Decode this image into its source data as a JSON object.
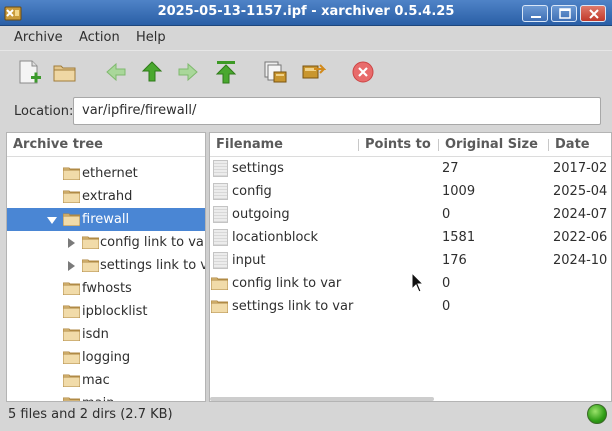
{
  "window": {
    "title": "2025-05-13-1157.ipf - xarchiver 0.5.4.25"
  },
  "menubar": {
    "items": [
      "Archive",
      "Action",
      "Help"
    ]
  },
  "toolbar": {
    "icons": [
      "new-archive-icon",
      "open-archive-icon",
      "back-arrow-icon",
      "up-arrow-icon",
      "forward-arrow-icon",
      "top-level-icon",
      "extract-icon",
      "add-files-icon",
      "stop-icon"
    ]
  },
  "location": {
    "label": "Location:",
    "value": "var/ipfire/firewall/"
  },
  "tree": {
    "header": "Archive tree",
    "items": [
      {
        "label": "ethernet",
        "selected": false
      },
      {
        "label": "extrahd",
        "selected": false
      },
      {
        "label": "firewall",
        "selected": true
      },
      {
        "label": "config link to var",
        "selected": false
      },
      {
        "label": "settings link to var",
        "selected": false
      },
      {
        "label": "fwhosts",
        "selected": false
      },
      {
        "label": "ipblocklist",
        "selected": false
      },
      {
        "label": "isdn",
        "selected": false
      },
      {
        "label": "logging",
        "selected": false
      },
      {
        "label": "mac",
        "selected": false
      },
      {
        "label": "main",
        "selected": false
      }
    ]
  },
  "files": {
    "columns": [
      "Filename",
      "Points to",
      "Original Size",
      "Date"
    ],
    "rows": [
      {
        "name": "settings",
        "points_to": "",
        "size": "27",
        "date": "2017-02",
        "type": "file"
      },
      {
        "name": "config",
        "points_to": "",
        "size": "1009",
        "date": "2025-04",
        "type": "file"
      },
      {
        "name": "outgoing",
        "points_to": "",
        "size": "0",
        "date": "2024-07",
        "type": "file"
      },
      {
        "name": "locationblock",
        "points_to": "",
        "size": "1581",
        "date": "2022-06",
        "type": "file"
      },
      {
        "name": "input",
        "points_to": "",
        "size": "176",
        "date": "2024-10",
        "type": "file"
      },
      {
        "name": "config link to var",
        "points_to": "",
        "size": "0",
        "date": "",
        "type": "folder"
      },
      {
        "name": "settings link to var",
        "points_to": "",
        "size": "0",
        "date": "",
        "type": "folder"
      }
    ]
  },
  "status": {
    "text": "5 files and 2 dirs  (2.7 KB)",
    "led_color": "#2f9d16"
  },
  "colors": {
    "titlebar": "#2a5fa6",
    "selection": "#4a86d4",
    "folder": "#e8c98a"
  }
}
